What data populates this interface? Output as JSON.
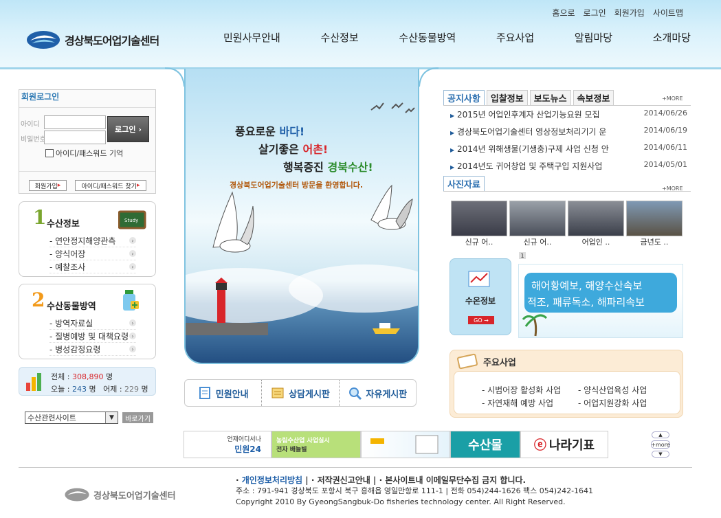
{
  "util_links": [
    "홈으로",
    "로그인",
    "회원가입",
    "사이트맵"
  ],
  "site_name": "경상북도어업기술센터",
  "gnb": [
    "민원사무안내",
    "수산정보",
    "수산동물방역",
    "주요사업",
    "알림마당",
    "소개마당"
  ],
  "login": {
    "title": "회원로그인",
    "id_label": "아이디",
    "pw_label": "비밀번호",
    "button": "로그인",
    "remember": "아이디/패스워드 기억",
    "join": "회원가입",
    "find": "아이디/패스워드 찾기"
  },
  "menu1": {
    "num": "1",
    "title": "수산정보",
    "items": [
      "- 연안정지해양관측",
      "- 양식어장",
      "- 예찰조사"
    ]
  },
  "menu2": {
    "num": "2",
    "title": "수산동물방역",
    "items": [
      "- 방역자료실",
      "- 질병예방 및 대책요령",
      "- 병성감정요령"
    ]
  },
  "visitor": {
    "total_label": "전체 :",
    "total": "308,890",
    "total_unit": "명",
    "today_label": "오늘 :",
    "today": "243",
    "today_unit": "명",
    "yesterday_label": "어제 :",
    "yesterday": "229",
    "yesterday_unit": "명"
  },
  "related": {
    "selected": "수산관련사이트",
    "go": "바로가기"
  },
  "visual": {
    "line1a": "풍요로운",
    "line1b": "바다!",
    "line2a": "살기좋은",
    "line2b": "어촌!",
    "line3a": "행복증진",
    "line3b": "경북수산!",
    "welcome": "경상북도어업기술센터 방문을 환영합니다."
  },
  "quick": [
    "민원안내",
    "상담게시판",
    "자유게시판"
  ],
  "tabs": [
    "공지사항",
    "입찰정보",
    "보도뉴스",
    "속보정보"
  ],
  "more": "+MORE",
  "notices": [
    {
      "title": "2015년 어업인후계자 산업기능요원 모집",
      "date": "2014/06/26"
    },
    {
      "title": "경상북도어업기술센터 영상정보처리기기 운",
      "date": "2014/06/19"
    },
    {
      "title": "2014년 위해생물(기생충)구제 사업 신청 안",
      "date": "2014/06/11"
    },
    {
      "title": "2014년도 귀어창업 및 주택구입 지원사업",
      "date": "2014/05/01"
    }
  ],
  "photo_tab": "사진자료",
  "photos": [
    "신규 어..",
    "신규 어..",
    "어업인 ..",
    "금년도 .."
  ],
  "photo_page": "1",
  "water": {
    "label": "수온정보",
    "go": "GO"
  },
  "banner_r": {
    "line1": "해어황예보, 해양수산속보",
    "line2": "적조, 패류독소, 해파리속보"
  },
  "biz": {
    "title": "주요사업",
    "items": [
      "- 시범어장 활성화 사업",
      "- 양식산업육성 사업",
      "- 자연재해 예방 사업",
      "- 어업지원강화 사업"
    ]
  },
  "banners": {
    "b1a": "언제어디서나",
    "b1b": "민원24",
    "b2a": "농림수산업 사업실시",
    "b2b": "전자 배늘빌",
    "b4": "수산물",
    "b5": "나라기표",
    "more": "+more"
  },
  "footer": {
    "policy": "개인정보처리방침",
    "l2": "저작권신고안내",
    "l3": "본사이트내 이메일무단수집 금지 합니다.",
    "address": "주소 : 791-941 경상북도 포항시 북구 흥해읍 영일만항로 111-1 | 전화 054)244-1626 팩스 054)242-1641",
    "copyright": "Copyright 2010 By GyeongSangbuk-Do fisheries technology center. All Right Reserved."
  },
  "colors": {
    "accent": "#2b78b3",
    "sky": "#bfe6f7",
    "red": "#d8252a",
    "green": "#2c8c2c"
  }
}
